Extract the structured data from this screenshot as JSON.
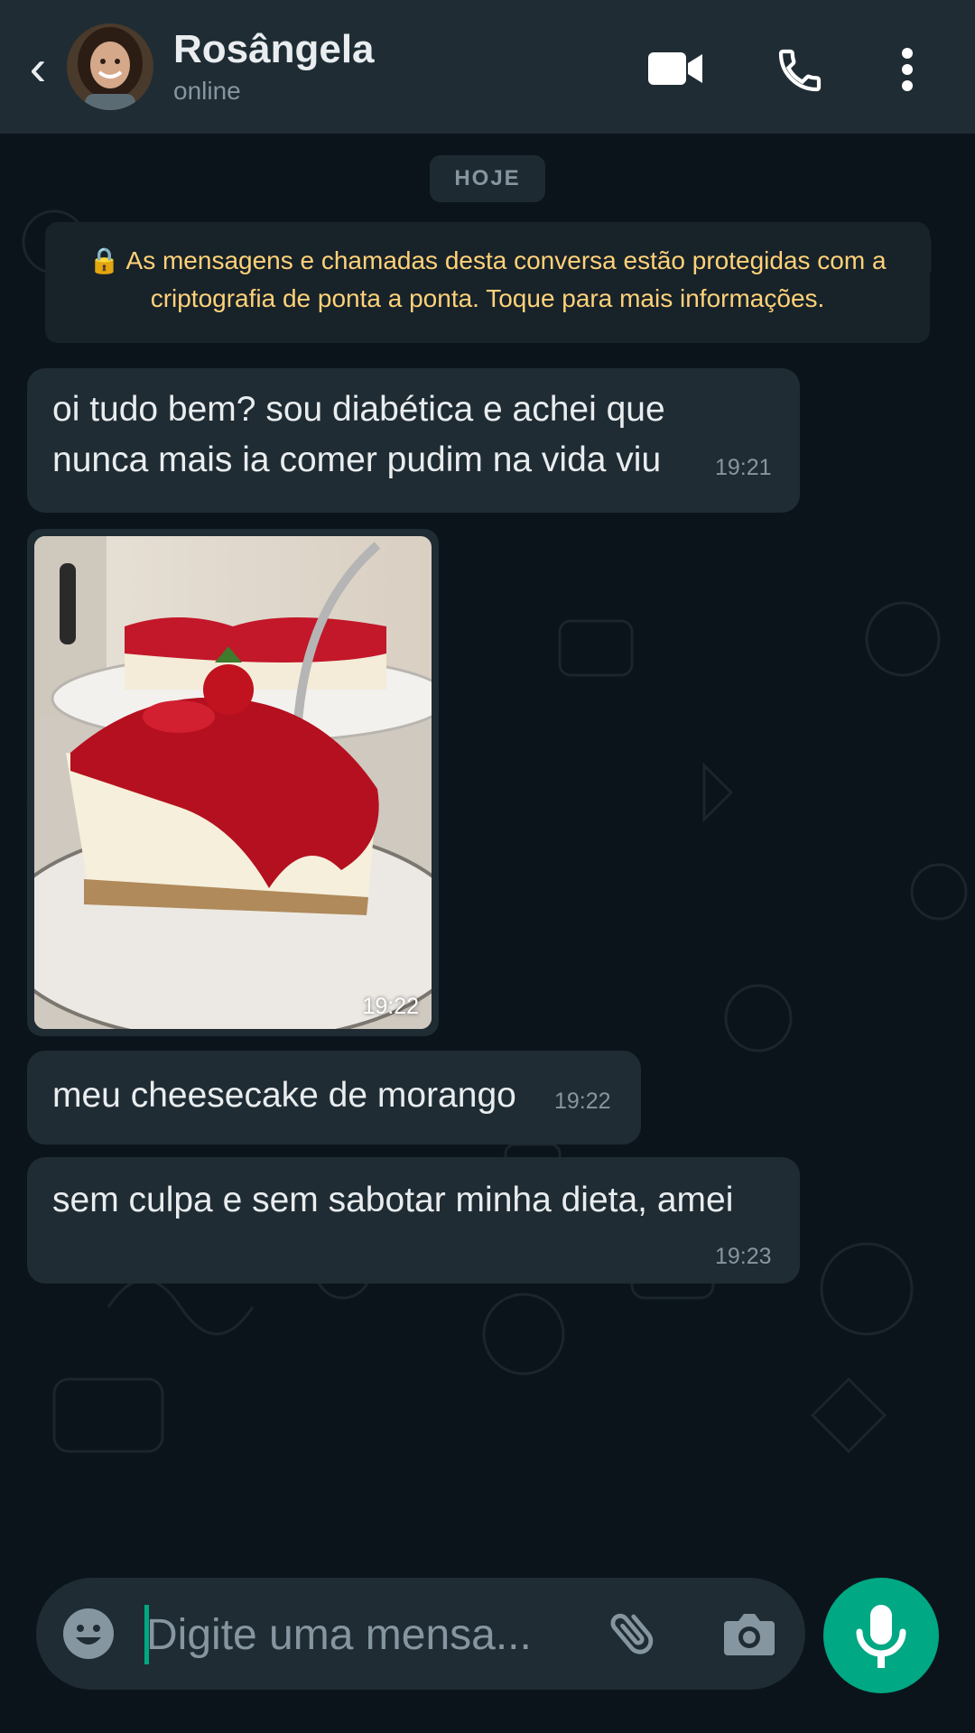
{
  "header": {
    "back_glyph": "‹",
    "contact_name": "Rosângela",
    "status": "online",
    "icons": [
      "video-call-icon",
      "voice-call-icon",
      "more-options-icon"
    ]
  },
  "chat": {
    "date_label": "HOJE",
    "encryption_notice": "🔒 As mensagens e chamadas desta conversa estão protegidas com a criptografia de ponta a ponta. Toque para mais informações.",
    "messages": [
      {
        "text": "oi tudo bem? sou diabética e achei que nunca mais ia comer pudim na vida viu",
        "time": "19:21"
      },
      {
        "type": "image",
        "description_icon": "cheesecake-photo",
        "time": "19:22"
      },
      {
        "text": "meu cheesecake de morango",
        "time": "19:22"
      },
      {
        "text": "sem culpa e sem sabotar minha dieta, amei",
        "time": "19:23"
      }
    ]
  },
  "composer": {
    "placeholder": "Digite uma mensa...",
    "icons": [
      "emoji-icon",
      "attach-icon",
      "camera-icon",
      "mic-icon"
    ]
  },
  "colors": {
    "header_bg": "#1f2c34",
    "chat_bg": "#0b141a",
    "bubble_bg": "#202c33",
    "notice_text": "#ffd279",
    "accent": "#00a884"
  }
}
